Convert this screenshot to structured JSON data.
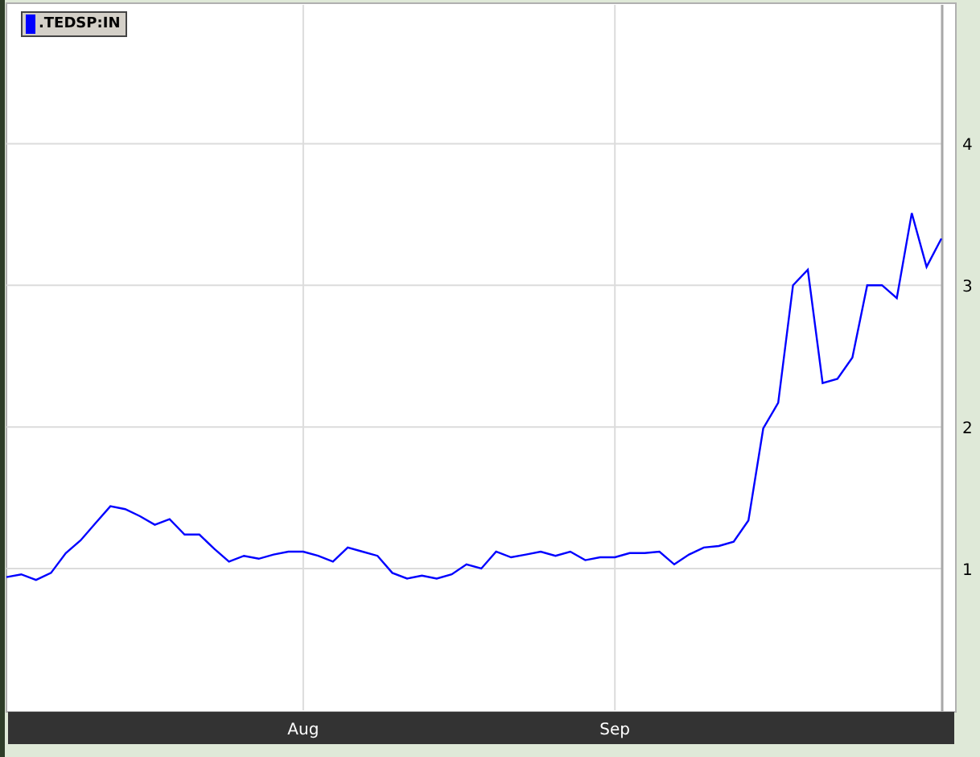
{
  "chart_data": {
    "type": "line",
    "categories": [
      null,
      null,
      null,
      null,
      null,
      null,
      null,
      null,
      null,
      null,
      null,
      null,
      null,
      null,
      null,
      null,
      null,
      null,
      null,
      null,
      "Aug",
      null,
      null,
      null,
      null,
      null,
      null,
      null,
      null,
      null,
      null,
      null,
      null,
      null,
      null,
      null,
      null,
      null,
      null,
      null,
      null,
      "Sep",
      null,
      null,
      null,
      null,
      null,
      null,
      null,
      null,
      null,
      null,
      null,
      null,
      null,
      null,
      null,
      null,
      null,
      null,
      null,
      null,
      null,
      null
    ],
    "series": [
      {
        "name": ".TEDSP:IN",
        "color": "#0000ff",
        "values": [
          0.94,
          0.96,
          0.92,
          0.97,
          1.11,
          1.2,
          1.32,
          1.44,
          1.42,
          1.37,
          1.31,
          1.35,
          1.24,
          1.24,
          1.14,
          1.05,
          1.09,
          1.07,
          1.1,
          1.12,
          1.12,
          1.09,
          1.05,
          1.15,
          1.12,
          1.09,
          0.97,
          0.93,
          0.95,
          0.93,
          0.96,
          1.03,
          1.0,
          1.12,
          1.08,
          1.1,
          1.12,
          1.09,
          1.12,
          1.06,
          1.08,
          1.08,
          1.11,
          1.11,
          1.12,
          1.03,
          1.1,
          1.15,
          1.16,
          1.19,
          1.34,
          1.99,
          2.17,
          3.0,
          3.11,
          2.31,
          2.34,
          2.49,
          3.0,
          3.0,
          2.91,
          3.51,
          3.13,
          3.33
        ]
      }
    ],
    "ylim": [
      0,
      4.98
    ],
    "grid": true,
    "yticks": [
      1,
      2,
      3,
      4
    ]
  }
}
